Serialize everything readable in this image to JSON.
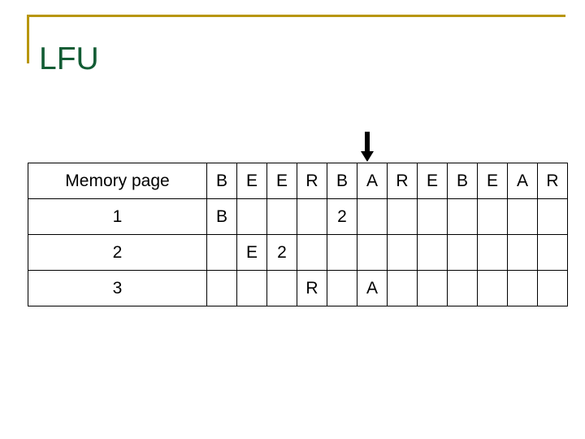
{
  "slide": {
    "title": "LFU",
    "title_color": "#125c34",
    "accent_color": "#b8960c"
  },
  "arrow": {
    "name": "down-arrow",
    "color": "#000000",
    "points_to_column_index": 5
  },
  "table": {
    "label_header": "Memory page",
    "sequence": [
      "B",
      "E",
      "E",
      "R",
      "B",
      "A",
      "R",
      "E",
      "B",
      "E",
      "A",
      "R"
    ],
    "page_color": "#bf7fd9",
    "count_color": "#a31515",
    "rows": [
      {
        "label": "1",
        "cells": [
          {
            "text": "B",
            "kind": "page"
          },
          {
            "text": "",
            "kind": "empty"
          },
          {
            "text": "",
            "kind": "empty"
          },
          {
            "text": "",
            "kind": "empty"
          },
          {
            "text": "2",
            "kind": "count"
          },
          {
            "text": "",
            "kind": "empty"
          },
          {
            "text": "",
            "kind": "empty"
          },
          {
            "text": "",
            "kind": "empty"
          },
          {
            "text": "",
            "kind": "empty"
          },
          {
            "text": "",
            "kind": "empty"
          },
          {
            "text": "",
            "kind": "empty"
          },
          {
            "text": "",
            "kind": "empty"
          }
        ]
      },
      {
        "label": "2",
        "cells": [
          {
            "text": "",
            "kind": "empty"
          },
          {
            "text": "E",
            "kind": "page"
          },
          {
            "text": "2",
            "kind": "count"
          },
          {
            "text": "",
            "kind": "empty"
          },
          {
            "text": "",
            "kind": "empty"
          },
          {
            "text": "",
            "kind": "empty"
          },
          {
            "text": "",
            "kind": "empty"
          },
          {
            "text": "",
            "kind": "empty"
          },
          {
            "text": "",
            "kind": "empty"
          },
          {
            "text": "",
            "kind": "empty"
          },
          {
            "text": "",
            "kind": "empty"
          },
          {
            "text": "",
            "kind": "empty"
          }
        ]
      },
      {
        "label": "3",
        "cells": [
          {
            "text": "",
            "kind": "empty"
          },
          {
            "text": "",
            "kind": "empty"
          },
          {
            "text": "",
            "kind": "empty"
          },
          {
            "text": "R",
            "kind": "page"
          },
          {
            "text": "",
            "kind": "empty"
          },
          {
            "text": "A",
            "kind": "page"
          },
          {
            "text": "",
            "kind": "empty"
          },
          {
            "text": "",
            "kind": "empty"
          },
          {
            "text": "",
            "kind": "empty"
          },
          {
            "text": "",
            "kind": "empty"
          },
          {
            "text": "",
            "kind": "empty"
          },
          {
            "text": "",
            "kind": "empty"
          }
        ]
      }
    ]
  }
}
